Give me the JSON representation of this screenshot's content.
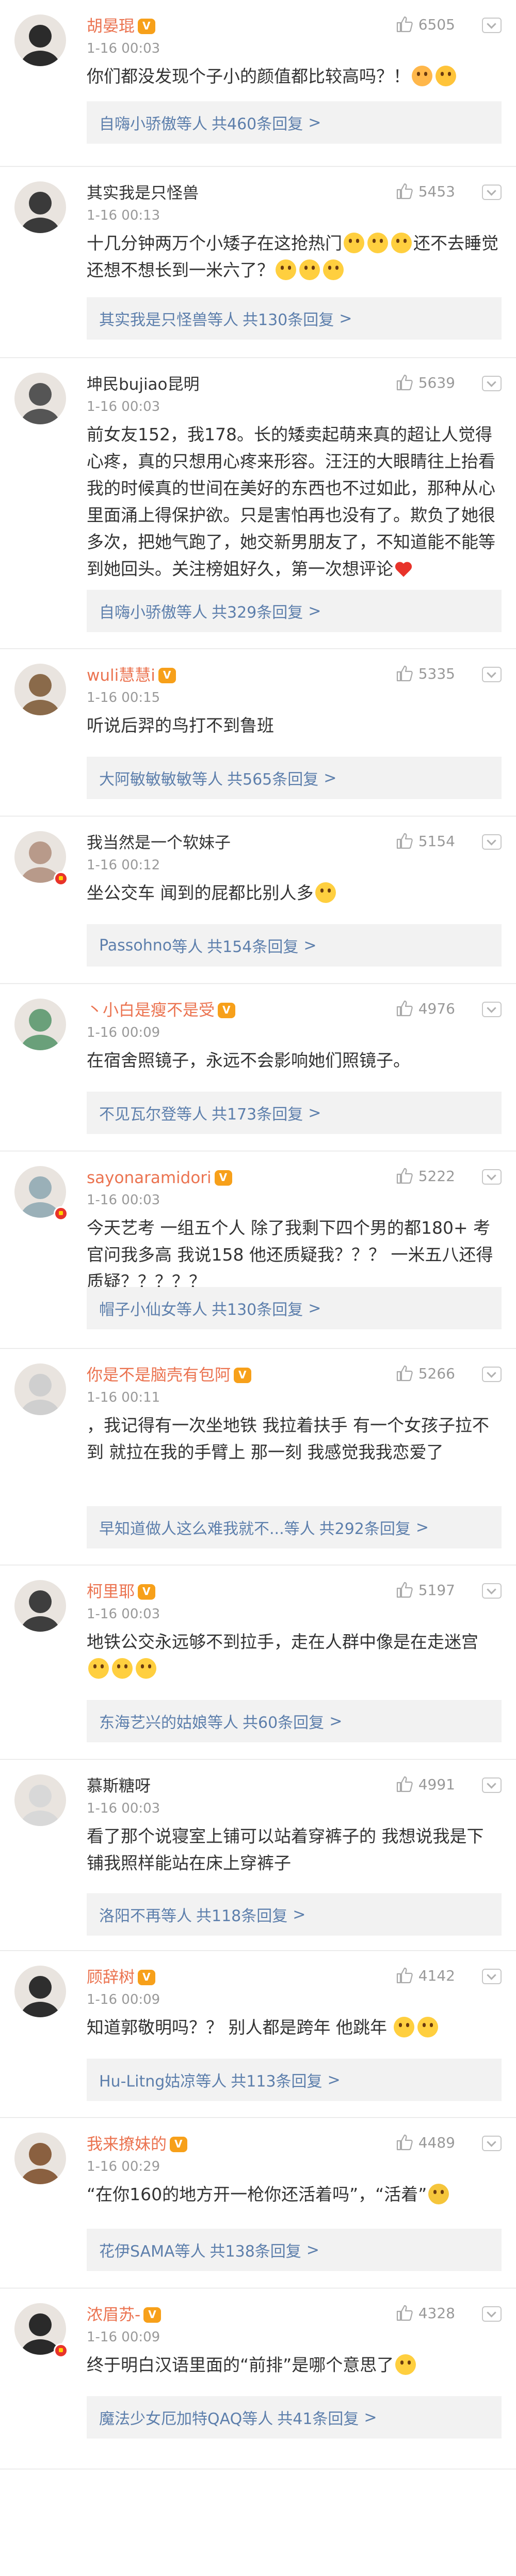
{
  "reply_suffix": "等人",
  "reply_arrow": ">",
  "comments": [
    {
      "username": "胡晏琨",
      "verified": false,
      "crown": true,
      "time": "1-16 00:03",
      "likes": "6505",
      "segments": [
        {
          "t": "你们都没发现个子小的颜值都比较高吗？！"
        },
        {
          "e": "blush"
        },
        {
          "e": "eek"
        }
      ],
      "reply_names": "自嗨小骄傲",
      "reply_count": "共460条回复",
      "avatar_color": "#2b2b2b"
    },
    {
      "username": "其实我是只怪兽",
      "verified": false,
      "crown": false,
      "time": "1-16 00:13",
      "likes": "5453",
      "segments": [
        {
          "t": "十几分钟两万个小矮子在这抢热门"
        },
        {
          "e": "cry"
        },
        {
          "e": "cry"
        },
        {
          "e": "cry"
        },
        {
          "t": "还不去睡觉 还想不想长到一米六了？"
        },
        {
          "e": "smile"
        },
        {
          "e": "smile"
        },
        {
          "e": "smile"
        }
      ],
      "reply_names": "其实我是只怪兽",
      "reply_count": "共130条回复",
      "avatar_color": "#3a3a3a"
    },
    {
      "username": "坤民bujiao昆明",
      "verified": false,
      "crown": false,
      "time": "1-16 00:03",
      "likes": "5639",
      "segments": [
        {
          "t": "前女友152，我178。长的矮卖起萌来真的超让人觉得心疼，真的只想用心疼来形容。汪汪的大眼睛往上抬看我的时候真的世间在美好的东西也不过如此，那种从心里面涌上得保护欲。只是害怕再也没有了。欺负了她很多次，把她气跑了，她交新男朋友了，不知道能不能等到她回头。关注榜姐好久，第一次想评论"
        },
        {
          "e": "heart"
        }
      ],
      "reply_names": "自嗨小骄傲",
      "reply_count": "共329条回复",
      "avatar_color": "#555555"
    },
    {
      "username": "wuli慧慧i",
      "verified": false,
      "crown": true,
      "time": "1-16 00:15",
      "likes": "5335",
      "segments": [
        {
          "t": "听说后羿的鸟打不到鲁班"
        }
      ],
      "reply_names": "大阿敏敏敏敏",
      "reply_count": "共565条回复",
      "avatar_color": "#8a6a4a"
    },
    {
      "username": "我当然是一个软妹子",
      "verified": true,
      "crown": false,
      "time": "1-16 00:12",
      "likes": "5154",
      "segments": [
        {
          "t": "坐公交车 闻到的屁都比别人多"
        },
        {
          "e": "smile"
        }
      ],
      "reply_names": "Passohno",
      "reply_count": "共154条回复",
      "avatar_color": "#b89a8a"
    },
    {
      "username": "丶小白是瘦不是受",
      "verified": false,
      "crown": true,
      "time": "1-16 00:09",
      "likes": "4976",
      "segments": [
        {
          "t": "在宿舍照镜子，永远不会影响她们照镜子。"
        }
      ],
      "reply_names": "不见瓦尔登",
      "reply_count": "共173条回复",
      "avatar_color": "#6aa07a"
    },
    {
      "username": "sayonaramidori",
      "verified": true,
      "crown": true,
      "time": "1-16 00:03",
      "likes": "5222",
      "segments": [
        {
          "t": "今天艺考 一组五个人 除了我剩下四个男的都180+ 考官问我多高 我说158 他还质疑我？？？ 一米五八还得质疑？？？？？"
        }
      ],
      "reply_names": "帽子小仙女",
      "reply_count": "共130条回复",
      "avatar_color": "#9ab0b8"
    },
    {
      "username": "你是不是脑壳有包阿",
      "verified": false,
      "crown": true,
      "time": "1-16 00:11",
      "likes": "5266",
      "segments": [
        {
          "t": "，我记得有一次坐地铁 我拉着扶手 有一个女孩子拉不到 就拉在我的手臂上 那一刻 我感觉我我恋爱了"
        }
      ],
      "reply_names": "早知道做人这么难我就不...",
      "reply_count": "共292条回复",
      "avatar_color": "#cfcfcf"
    },
    {
      "username": "柯里耶",
      "verified": false,
      "crown": true,
      "time": "1-16 00:03",
      "likes": "5197",
      "segments": [
        {
          "t": "地铁公交永远够不到拉手，走在人群中像是在走迷宫"
        },
        {
          "e": "smile"
        },
        {
          "e": "smile"
        },
        {
          "e": "smile"
        }
      ],
      "reply_names": "东海艺兴的姑娘",
      "reply_count": "共60条回复",
      "avatar_color": "#3e3e3e"
    },
    {
      "username": "慕斯糖呀",
      "verified": false,
      "crown": false,
      "time": "1-16 00:03",
      "likes": "4991",
      "segments": [
        {
          "t": "看了那个说寝室上铺可以站着穿裤子的 我想说我是下铺我照样能站在床上穿裤子"
        }
      ],
      "reply_names": "洛阳不再",
      "reply_count": "共118条回复",
      "avatar_color": "#d8d8d8"
    },
    {
      "username": "顾辞树",
      "verified": false,
      "crown": true,
      "time": "1-16 00:09",
      "likes": "4142",
      "segments": [
        {
          "t": "知道郭敬明吗？？ 别人都是跨年 他跳年 "
        },
        {
          "e": "smile"
        },
        {
          "e": "smile"
        }
      ],
      "reply_names": "Hu-Litng姑凉",
      "reply_count": "共113条回复",
      "avatar_color": "#2e2e2e"
    },
    {
      "username": "我来撩妹的",
      "verified": false,
      "crown": true,
      "time": "1-16 00:29",
      "likes": "4489",
      "segments": [
        {
          "t": "“在你160的地方开一枪你还活着吗”，“活着”"
        },
        {
          "e": "wink"
        }
      ],
      "reply_names": "花伊SAMA",
      "reply_count": "共138条回复",
      "avatar_color": "#8a6040"
    },
    {
      "username": "浓眉苏-",
      "verified": true,
      "crown": true,
      "time": "1-16 00:09",
      "likes": "4328",
      "segments": [
        {
          "t": "终于明白汉语里面的“前排”是哪个意思了"
        },
        {
          "e": "smile"
        }
      ],
      "reply_names": "魔法少女厄加特QAQ",
      "reply_count": "共41条回复",
      "avatar_color": "#2a2a2a"
    }
  ]
}
